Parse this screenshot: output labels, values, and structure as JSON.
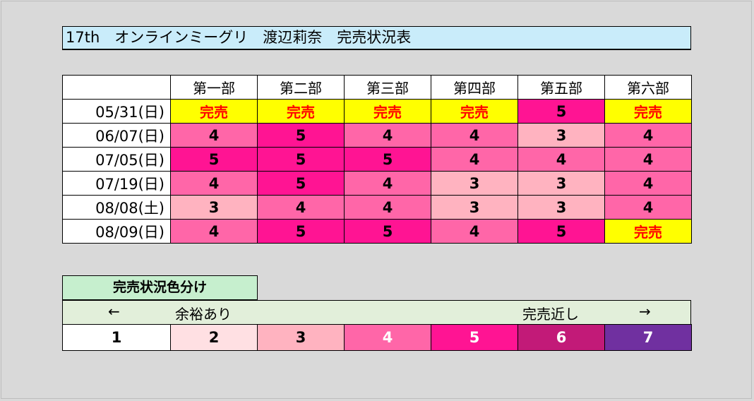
{
  "title": "17th　オンラインミーグリ　渡辺莉奈　完売状況表",
  "columns": [
    "第一部",
    "第二部",
    "第三部",
    "第四部",
    "第五部",
    "第六部"
  ],
  "rows": [
    {
      "date": "05/31(日)",
      "cells": [
        "完売",
        "完売",
        "完売",
        "完売",
        "5",
        "完売"
      ]
    },
    {
      "date": "06/07(日)",
      "cells": [
        "4",
        "5",
        "4",
        "4",
        "3",
        "4"
      ]
    },
    {
      "date": "07/05(日)",
      "cells": [
        "5",
        "5",
        "5",
        "4",
        "4",
        "4"
      ]
    },
    {
      "date": "07/19(日)",
      "cells": [
        "4",
        "5",
        "4",
        "3",
        "3",
        "4"
      ]
    },
    {
      "date": "08/08(土)",
      "cells": [
        "3",
        "4",
        "4",
        "3",
        "3",
        "4"
      ]
    },
    {
      "date": "08/09(日)",
      "cells": [
        "4",
        "5",
        "5",
        "4",
        "5",
        "完売"
      ]
    }
  ],
  "legend": {
    "heading": "完売状況色分け",
    "left_arrow": "←",
    "left_text": "余裕あり",
    "right_text": "完売近し",
    "right_arrow": "→",
    "scale": [
      "1",
      "2",
      "3",
      "4",
      "5",
      "6",
      "7"
    ]
  },
  "colors": {
    "sold": "#ffff00",
    "sold_text": "#ff0000",
    "level_1": "#ffffff",
    "level_2": "#ffe0e3",
    "level_3": "#ffb3c0",
    "level_4": "#ff66a8",
    "level_5": "#ff1493",
    "level_6": "#c21a78",
    "level_7": "#7030a0"
  }
}
